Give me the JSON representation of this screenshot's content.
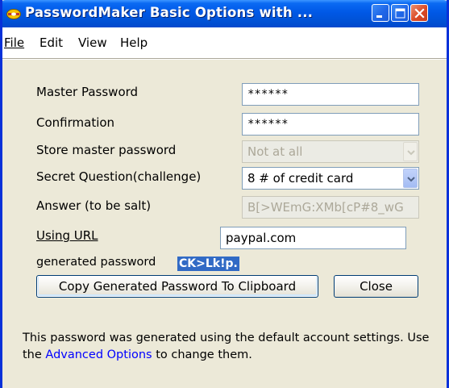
{
  "window": {
    "title": "PasswordMaker Basic Options with ..."
  },
  "menu": {
    "file": "File",
    "edit": "Edit",
    "view": "View",
    "help": "Help"
  },
  "form": {
    "master_password": {
      "label": "Master Password",
      "value": "******"
    },
    "confirmation": {
      "label": "Confirmation",
      "value": "******"
    },
    "store_master_password": {
      "label": "Store master password",
      "selected": "Not at all",
      "enabled": false
    },
    "secret_question": {
      "label": "Secret Question(challenge)",
      "selected": "8 # of credit card"
    },
    "answer": {
      "label": "Answer (to be salt)",
      "value": "B[>WEmG:XMb[cP#8_wG",
      "enabled": false
    },
    "using_url": {
      "label": "Using URL",
      "value": "paypal.com"
    },
    "generated_password": {
      "label": "generated password",
      "value": "CK>Lk!p."
    }
  },
  "buttons": {
    "copy": "Copy Generated Password To Clipboard",
    "close": "Close"
  },
  "footer": {
    "text_before_link": "This password was generated using the default account settings. Use the ",
    "link": "Advanced Options",
    "text_after_link": " to change them."
  },
  "colors": {
    "titlebar": "#0058e6",
    "selection": "#316ac5",
    "link": "#0000ff",
    "window_bg": "#ece9d8"
  },
  "icons": {
    "title": "passwordmaker-icon",
    "minimize": "minimize-icon",
    "maximize": "maximize-icon",
    "close": "close-icon",
    "dropdown": "chevron-down-icon"
  }
}
